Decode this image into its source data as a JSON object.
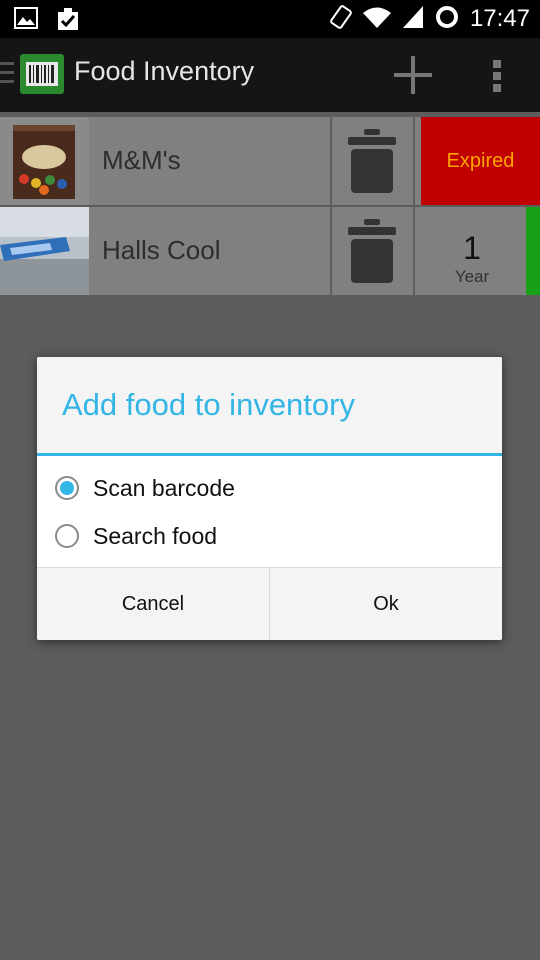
{
  "status_bar": {
    "time": "17:47",
    "icons": [
      "gallery-icon",
      "task-done-icon",
      "screen-rotation-icon",
      "wifi-icon",
      "signal-icon",
      "sync-icon"
    ]
  },
  "action_bar": {
    "title": "Food Inventory",
    "actions": [
      "add-icon",
      "overflow-menu-icon"
    ]
  },
  "items": [
    {
      "name": "M&M's",
      "status": "Expired",
      "status_color": "#c00000",
      "status_text_color": "#ffa500"
    },
    {
      "name": "Halls Cool",
      "remaining_value": "1",
      "remaining_unit": "Year",
      "indicator_color": "#18a018"
    }
  ],
  "dialog": {
    "title": "Add food to inventory",
    "options": [
      {
        "label": "Scan barcode",
        "selected": true
      },
      {
        "label": "Search food",
        "selected": false
      }
    ],
    "buttons": {
      "cancel": "Cancel",
      "ok": "Ok"
    }
  },
  "colors": {
    "accent": "#33b5e5",
    "action_bar": "#151515",
    "dim_background": "#5c5c5c"
  }
}
